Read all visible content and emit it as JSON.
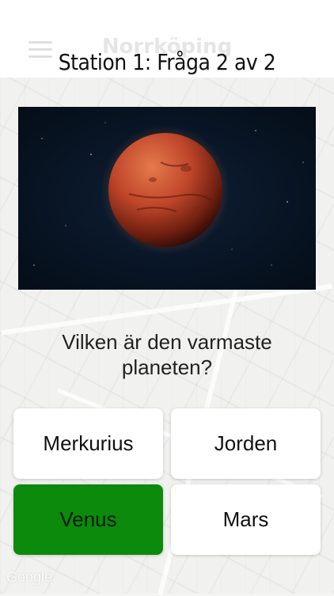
{
  "header": {
    "city_name": "Norrköping",
    "title": "Station 1: Fråga 2 av 2",
    "menu_icon": "hamburger-menu-icon"
  },
  "question": {
    "image_subject": "mars-planet",
    "text": "Vilken är den varmaste planeten?"
  },
  "answers": [
    {
      "label": "Merkurius",
      "state": "default"
    },
    {
      "label": "Jorden",
      "state": "default"
    },
    {
      "label": "Venus",
      "state": "correct"
    },
    {
      "label": "Mars",
      "state": "default"
    }
  ],
  "colors": {
    "correct": "#0b8a0b",
    "answer_bg": "#ffffff",
    "space_bg": "#081626",
    "planet": "#c0462a"
  },
  "map": {
    "attribution": "Google"
  }
}
